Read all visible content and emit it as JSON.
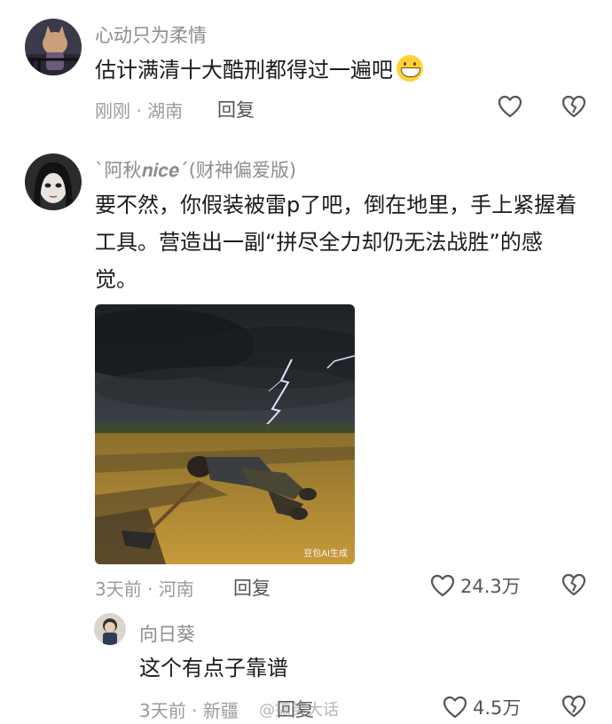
{
  "comments": [
    {
      "username": "心动只为柔情",
      "text": "估计满清十大酷刑都得过一遍吧",
      "emoji": "grin-emoji",
      "meta": "刚刚 · 湖南",
      "reply": "回复"
    },
    {
      "username": "`阿秋𝒏𝒊𝒄𝒆´(财神偏爱版)",
      "text": "要不然，你假装被雷p了吧，倒在地里，手上紧握着工具。营造出一副“拼尽全力却仍无法战胜”的感觉。",
      "image_tag": "豆包AI生成",
      "meta": "3天前 · 河南",
      "reply": "回复",
      "likes": "24.3万"
    },
    {
      "username": "向日葵",
      "text": "这个有点子靠谱",
      "meta": "3天前 · 新疆",
      "reply": "回复",
      "likes": "4.5万"
    }
  ],
  "watermark": "@搞笑大话"
}
